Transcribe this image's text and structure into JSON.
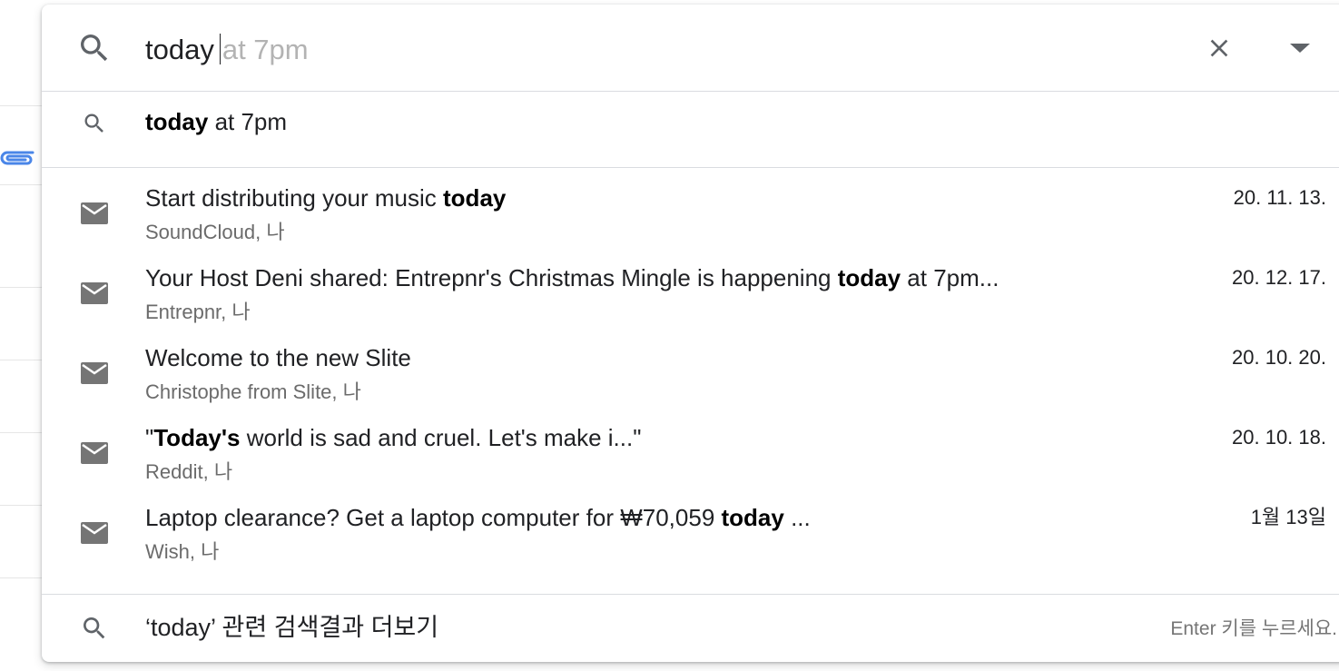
{
  "search": {
    "typed": "today",
    "autocomplete": "at 7pm"
  },
  "suggestion": {
    "bold": "today",
    "rest": " at 7pm"
  },
  "results": [
    {
      "subject_parts": [
        {
          "t": "Start distributing your music ",
          "b": false
        },
        {
          "t": "today",
          "b": true
        }
      ],
      "sender": "SoundCloud, 나",
      "date": "20. 11. 13."
    },
    {
      "subject_parts": [
        {
          "t": "Your Host Deni shared: Entrepnr's Christmas Mingle is happening ",
          "b": false
        },
        {
          "t": "today",
          "b": true
        },
        {
          "t": " at 7pm...",
          "b": false
        }
      ],
      "sender": "Entrepnr, 나",
      "date": "20. 12. 17."
    },
    {
      "subject_parts": [
        {
          "t": "Welcome to the new Slite",
          "b": false
        }
      ],
      "sender": "Christophe from Slite, 나",
      "date": "20. 10. 20."
    },
    {
      "subject_parts": [
        {
          "t": "\"",
          "b": false
        },
        {
          "t": "Today's",
          "b": true
        },
        {
          "t": " world is sad and cruel. Let's make i...\"",
          "b": false
        }
      ],
      "sender": "Reddit, 나",
      "date": "20. 10. 18."
    },
    {
      "subject_parts": [
        {
          "t": "Laptop clearance? Get a laptop computer for ₩70,059 ",
          "b": false
        },
        {
          "t": "today",
          "b": true
        },
        {
          "t": " ...",
          "b": false
        }
      ],
      "sender": "Wish, 나",
      "date": "1월 13일"
    }
  ],
  "more": {
    "label": "‘today’ 관련 검색결과 더보기",
    "hint": "Enter 키를 누르세요."
  },
  "icons": {
    "search": "search-icon",
    "clear": "close-icon",
    "options": "dropdown-arrow-icon",
    "mail": "mail-icon",
    "attachment": "paperclip-icon"
  },
  "colors": {
    "icon": "#5f6368",
    "mail_icon": "#757575",
    "attachment": "#4a86e8",
    "ghost_text": "#b3b3b3",
    "secondary_text": "#6b6b6b"
  }
}
